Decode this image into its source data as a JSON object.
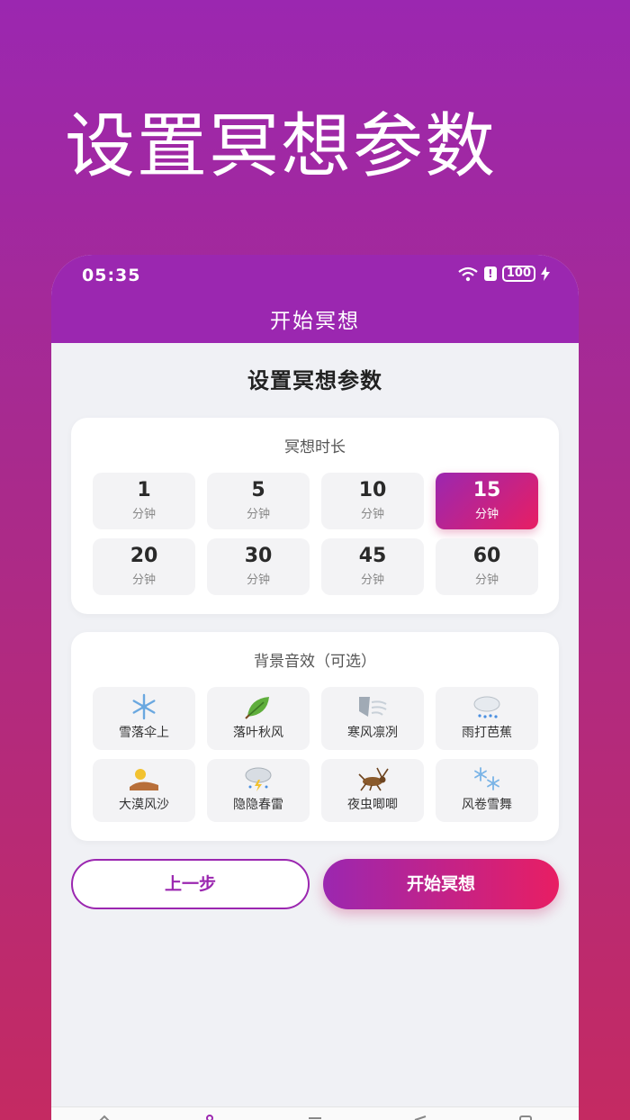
{
  "promo": {
    "title": "设置冥想参数"
  },
  "status_bar": {
    "time": "05:35",
    "battery": "100"
  },
  "app": {
    "title": "开始冥想"
  },
  "page": {
    "heading": "设置冥想参数"
  },
  "duration": {
    "title": "冥想时长",
    "selected_index": 3,
    "options": [
      {
        "value": "1",
        "unit": "分钟"
      },
      {
        "value": "5",
        "unit": "分钟"
      },
      {
        "value": "10",
        "unit": "分钟"
      },
      {
        "value": "15",
        "unit": "分钟"
      },
      {
        "value": "20",
        "unit": "分钟"
      },
      {
        "value": "30",
        "unit": "分钟"
      },
      {
        "value": "45",
        "unit": "分钟"
      },
      {
        "value": "60",
        "unit": "分钟"
      }
    ]
  },
  "sounds": {
    "title": "背景音效（可选）",
    "options": [
      {
        "label": "雪落伞上",
        "icon": "snowflake-icon"
      },
      {
        "label": "落叶秋风",
        "icon": "leaf-icon"
      },
      {
        "label": "寒风凛冽",
        "icon": "wind-icon"
      },
      {
        "label": "雨打芭蕉",
        "icon": "rain-cloud-icon"
      },
      {
        "label": "大漠风沙",
        "icon": "desert-icon"
      },
      {
        "label": "隐隐春雷",
        "icon": "thunder-cloud-icon"
      },
      {
        "label": "夜虫唧唧",
        "icon": "cricket-icon"
      },
      {
        "label": "风卷雪舞",
        "icon": "snow-swirl-icon"
      }
    ]
  },
  "buttons": {
    "prev": "上一步",
    "start": "开始冥想"
  },
  "colors": {
    "primary": "#9b27b0",
    "accent": "#e81e63",
    "background": "#f0f1f5"
  }
}
